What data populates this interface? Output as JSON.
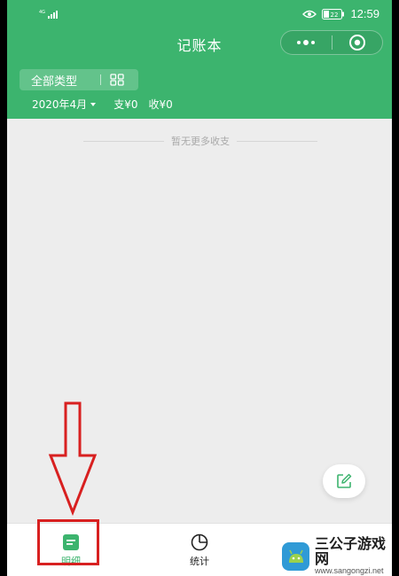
{
  "status_bar": {
    "network_label": "4G",
    "battery_level": "22",
    "time": "12:59"
  },
  "header": {
    "title": "记账本",
    "type_filter_label": "全部类型",
    "month": "2020年4月",
    "spend": "支¥0",
    "income": "收¥0"
  },
  "main": {
    "empty_text": "暂无更多收支"
  },
  "tabbar": {
    "items": [
      {
        "label": "明细",
        "icon": "list-icon",
        "active": true
      },
      {
        "label": "统计",
        "icon": "pie-chart-icon",
        "active": false
      }
    ]
  },
  "watermark": {
    "name": "三公子游戏网",
    "url": "www.sangongzi.net"
  },
  "colors": {
    "brand": "#3cb46e",
    "background": "#ededed",
    "annotation": "#d82020"
  }
}
